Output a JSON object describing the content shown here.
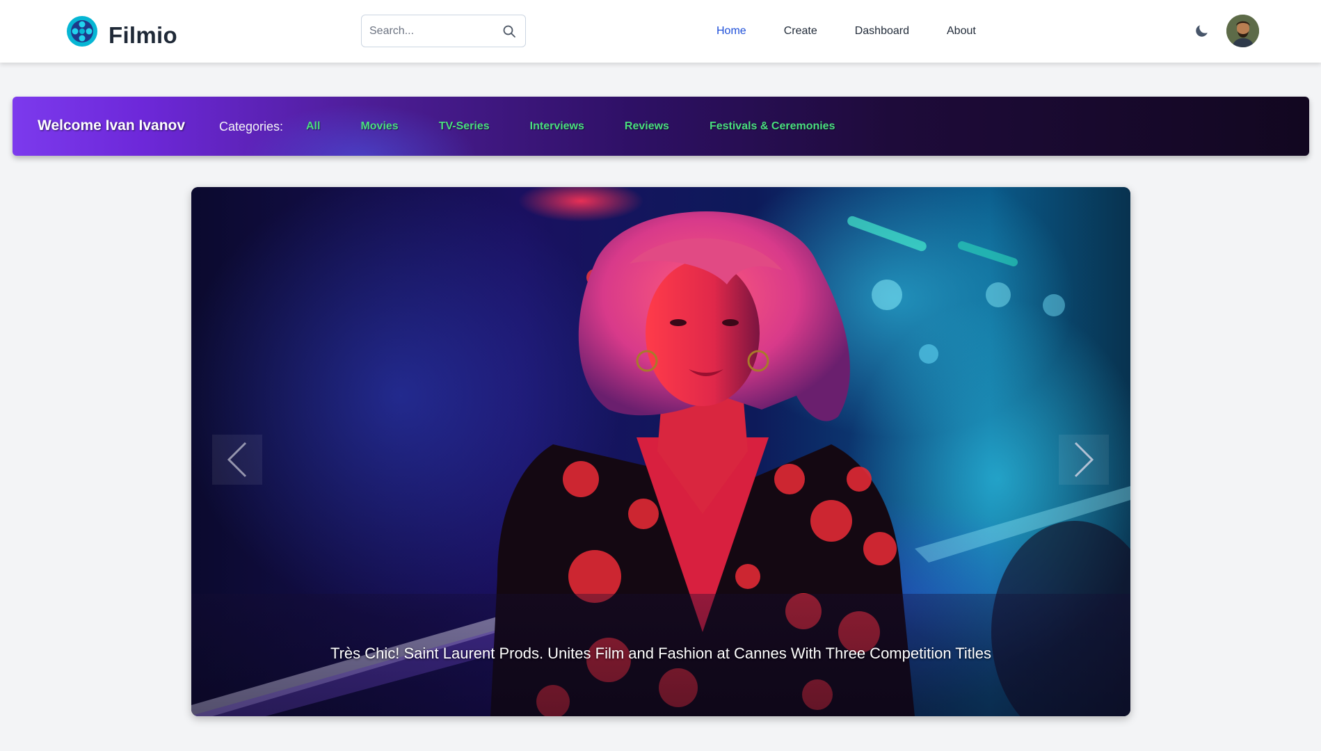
{
  "brand": {
    "name": "Filmio",
    "icon": "film-reel-icon",
    "icon_color": "#06b6d4"
  },
  "search": {
    "placeholder": "Search...",
    "icon": "search-icon"
  },
  "nav": {
    "items": [
      {
        "label": "Home",
        "active": true
      },
      {
        "label": "Create",
        "active": false
      },
      {
        "label": "Dashboard",
        "active": false
      },
      {
        "label": "About",
        "active": false
      }
    ],
    "active_color": "#1d4ed8"
  },
  "header_actions": {
    "theme_icon": "moon-icon",
    "avatar_icon": "user-avatar"
  },
  "welcome": {
    "title": "Welcome Ivan Ivanov",
    "categories_label": "Categories:",
    "categories": [
      "All",
      "Movies",
      "TV-Series",
      "Interviews",
      "Reviews",
      "Festivals & Ceremonies"
    ],
    "link_color": "#4ade80"
  },
  "carousel": {
    "caption": "Très Chic! Saint Laurent Prods. Unites Film and Fashion at Cannes With Three Competition Titles",
    "prev_icon": "chevron-left-icon",
    "next_icon": "chevron-right-icon"
  }
}
